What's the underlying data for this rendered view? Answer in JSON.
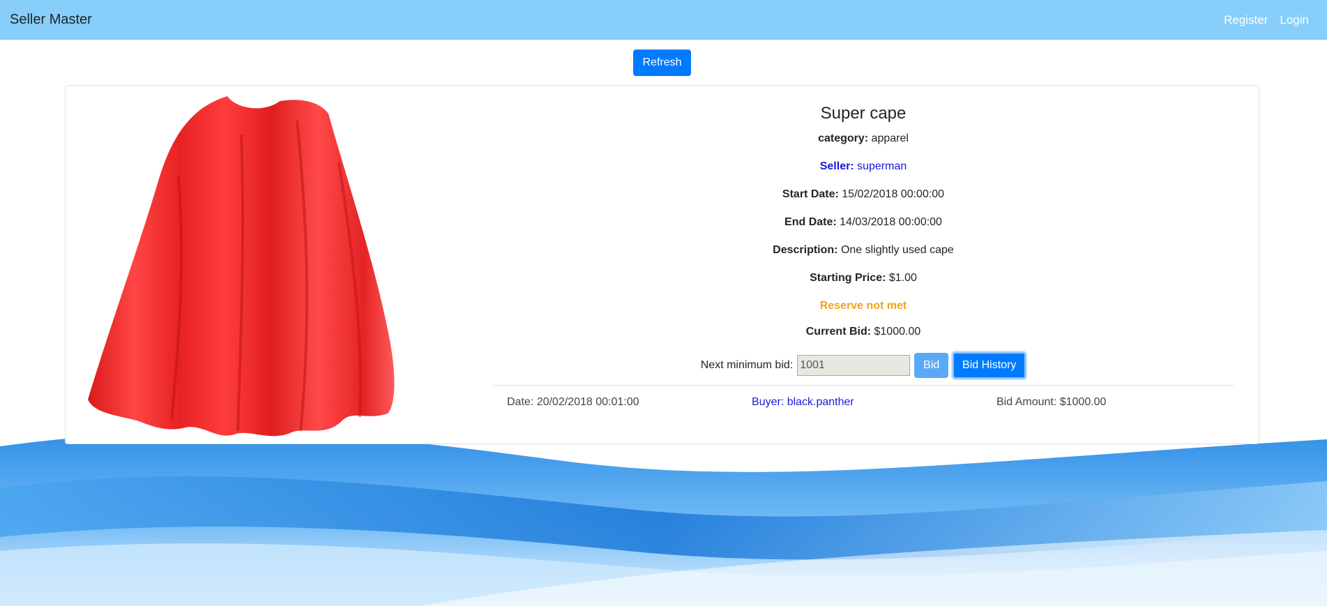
{
  "navbar": {
    "brand": "Seller Master",
    "links": [
      "Register",
      "Login"
    ]
  },
  "toolbar": {
    "refresh_label": "Refresh"
  },
  "product": {
    "title": "Super cape",
    "category_label": "category:",
    "category_value": " apparel",
    "seller_label": "Seller:",
    "seller_value": " superman",
    "start_label": "Start Date:",
    "start_value": " 15/02/2018 00:00:00",
    "end_label": "End Date:",
    "end_value": " 14/03/2018 00:00:00",
    "description_label": "Description:",
    "description_value": " One slightly used cape",
    "starting_price_label": "Starting Price:",
    "starting_price_value": " $1.00",
    "reserve_status": "Reserve not met",
    "current_bid_label": "Current Bid:",
    "current_bid_value": " $1000.00"
  },
  "bid": {
    "next_min_label": "Next minimum bid:",
    "input_value": "1001",
    "bid_label": "Bid",
    "history_label": "Bid History"
  },
  "history": [
    {
      "date": "Date: 20/02/2018 00:01:00",
      "buyer": "Buyer: black.panther",
      "amount": "Bid Amount: $1000.00"
    }
  ],
  "colors": {
    "navbar": "#87cefa",
    "primary": "#007bff",
    "link": "#1a1adc",
    "reserve": "#f5a01a"
  }
}
